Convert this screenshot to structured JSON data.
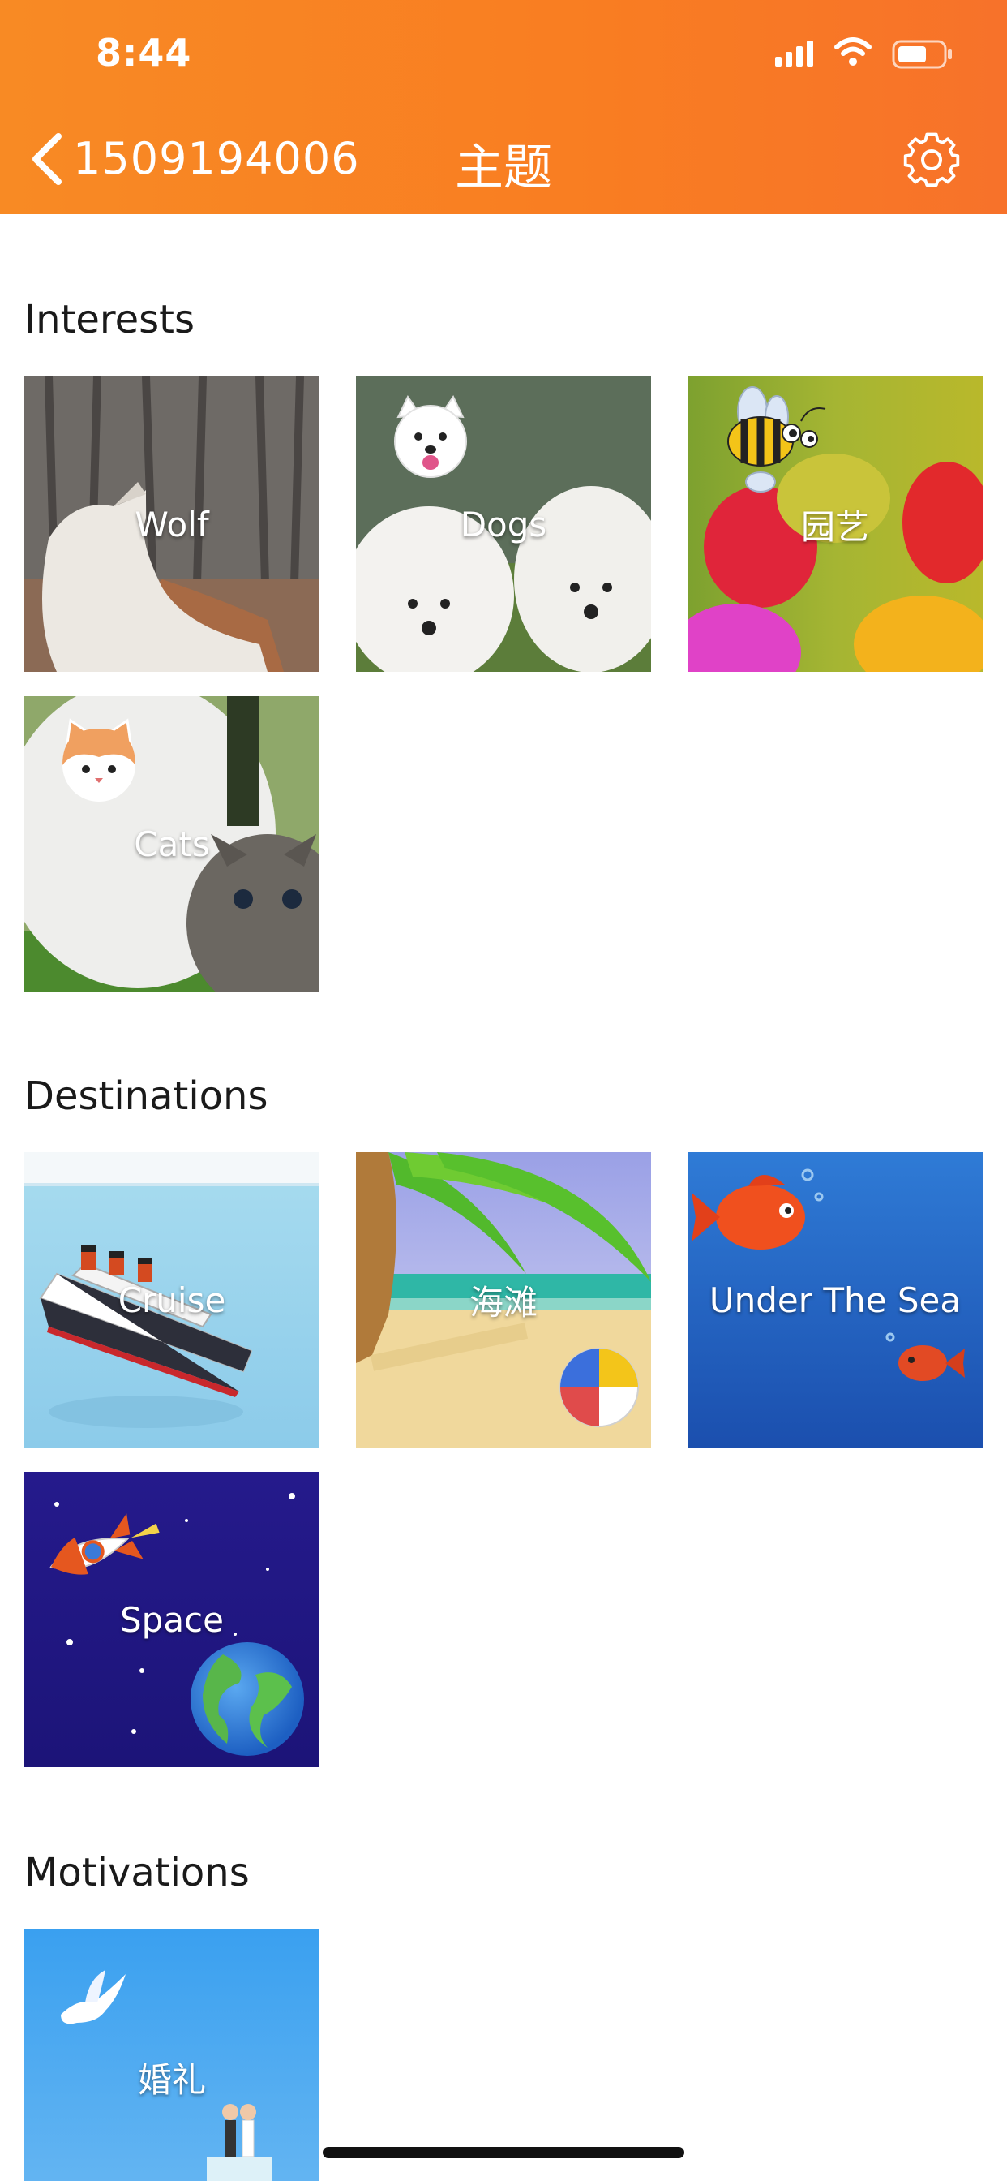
{
  "status_bar": {
    "time": "8:44"
  },
  "nav": {
    "back_label": "1509194006",
    "title": "主题"
  },
  "sections": [
    {
      "title": "Interests",
      "tiles": [
        {
          "label": "Wolf"
        },
        {
          "label": "Dogs"
        },
        {
          "label": "园艺"
        },
        {
          "label": "Cats"
        }
      ]
    },
    {
      "title": "Destinations",
      "tiles": [
        {
          "label": "Cruise"
        },
        {
          "label": "海滩"
        },
        {
          "label": "Under The Sea"
        },
        {
          "label": "Space"
        }
      ]
    },
    {
      "title": "Motivations",
      "tiles": [
        {
          "label": "婚礼"
        }
      ]
    }
  ],
  "colors": {
    "header_start": "#f88a24",
    "header_end": "#f7722a"
  }
}
